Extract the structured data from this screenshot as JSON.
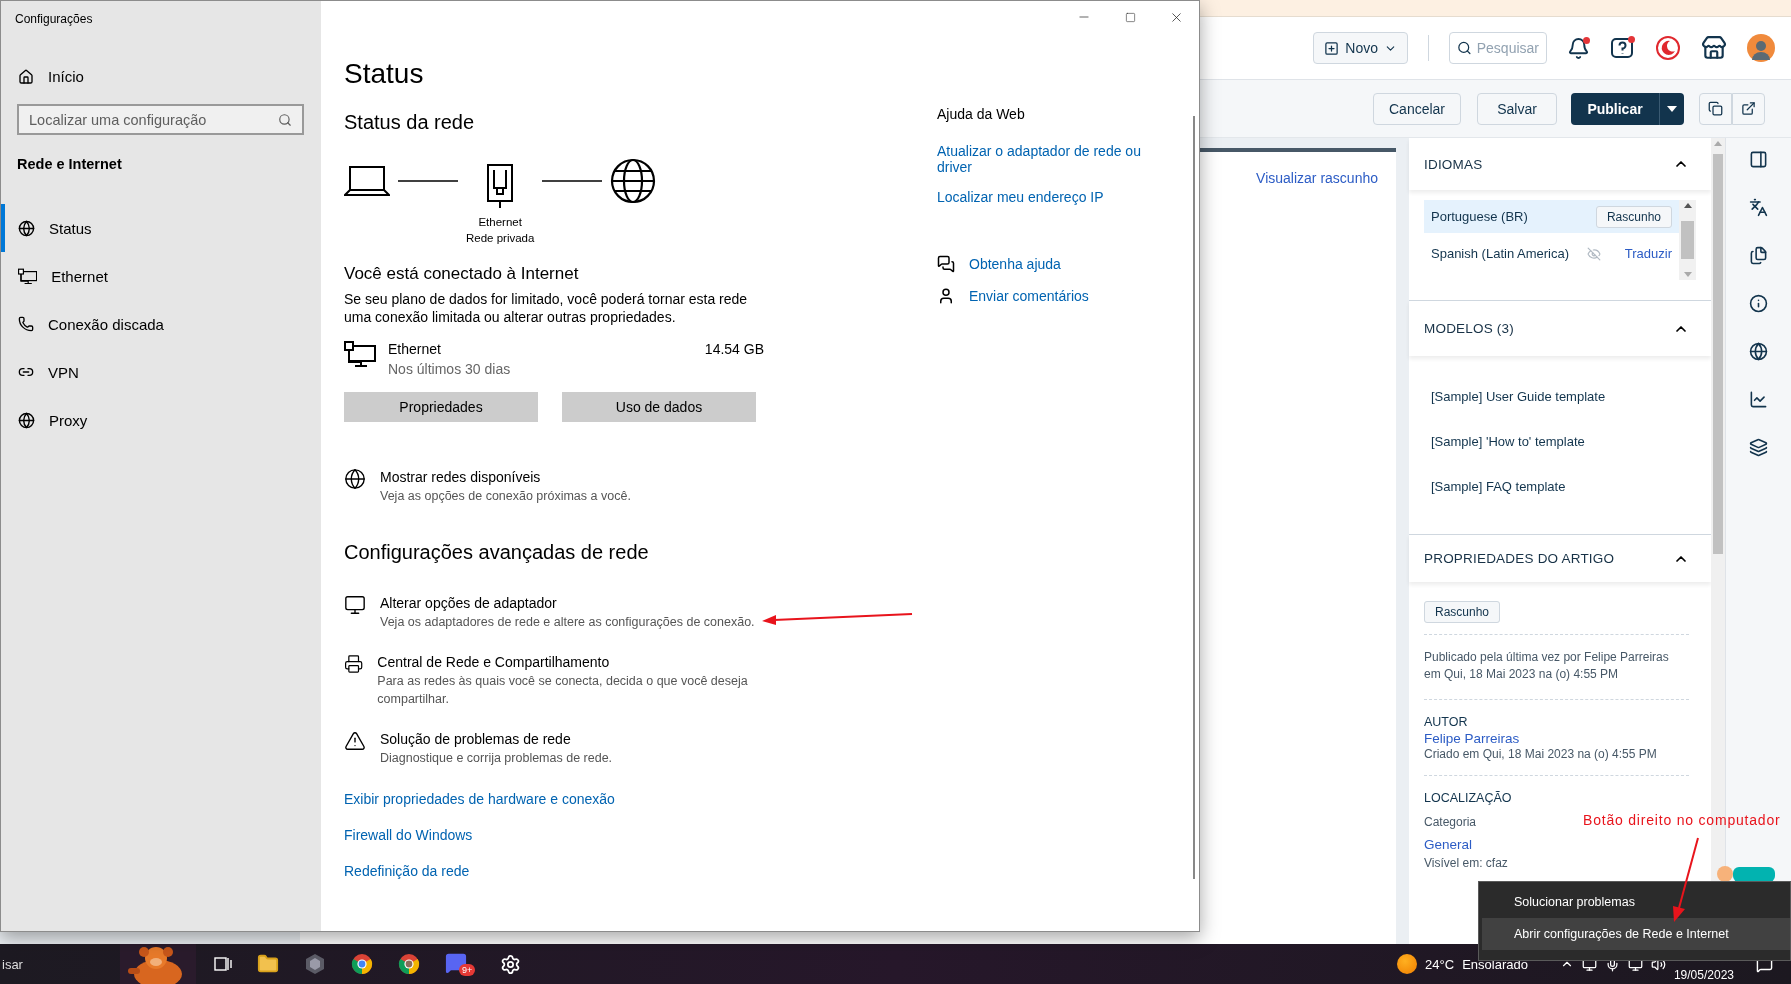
{
  "settings_window": {
    "title": "Configurações",
    "sidebar": {
      "home": "Início",
      "search_placeholder": "Localizar uma configuração",
      "section": "Rede e Internet",
      "items": [
        {
          "label": "Status",
          "selected": true
        },
        {
          "label": "Ethernet",
          "selected": false
        },
        {
          "label": "Conexão discada",
          "selected": false
        },
        {
          "label": "VPN",
          "selected": false
        },
        {
          "label": "Proxy",
          "selected": false
        }
      ]
    },
    "page": {
      "title": "Status",
      "network_heading": "Status da rede",
      "diagram": {
        "adapter": "Ethernet",
        "network": "Rede privada"
      },
      "connected": "Você está conectado à Internet",
      "description": "Se seu plano de dados for limitado, você poderá tornar esta rede uma conexão limitada ou alterar outras propriedades.",
      "usage": {
        "name": "Ethernet",
        "period": "Nos últimos 30 dias",
        "amount": "14.54 GB"
      },
      "buttons": [
        "Propriedades",
        "Uso de dados"
      ],
      "show_networks": {
        "title": "Mostrar redes disponíveis",
        "subtitle": "Veja as opções de conexão próximas a você."
      },
      "advanced_heading": "Configurações avançadas de rede",
      "advanced_items": [
        {
          "title": "Alterar opções de adaptador",
          "subtitle": "Veja os adaptadores de rede e altere as configurações de conexão."
        },
        {
          "title": "Central de Rede e Compartilhamento",
          "subtitle": "Para as redes às quais você se conecta, decida o que você deseja compartilhar."
        },
        {
          "title": "Solução de problemas de rede",
          "subtitle": "Diagnostique e corrija problemas de rede."
        }
      ],
      "links": [
        "Exibir propriedades de hardware e conexão",
        "Firewall do Windows",
        "Redefinição da rede"
      ],
      "help": {
        "title": "Ajuda da Web",
        "links": [
          "Atualizar o adaptador de rede ou driver",
          "Localizar meu endereço IP"
        ],
        "actions": [
          "Obtenha ajuda",
          "Enviar comentários"
        ]
      }
    }
  },
  "web_app": {
    "header": {
      "new_button": "Novo",
      "search_placeholder": "Pesquisar"
    },
    "toolbar": {
      "buttons": [
        "Cancelar",
        "Salvar"
      ],
      "publish": "Publicar"
    },
    "preview_link": "Visualizar rascunho",
    "languages": {
      "title": "IDIOMAS",
      "expanded": true,
      "items": [
        {
          "name": "Portuguese (BR)",
          "selected": true,
          "status": "Rascunho"
        },
        {
          "name": "Spanish (Latin America)",
          "selected": false,
          "action": "Traduzir"
        }
      ]
    },
    "templates": {
      "title": "MODELOS (3)",
      "expanded": true,
      "items": [
        "[Sample] User Guide template",
        "[Sample] 'How to' template",
        "[Sample] FAQ template"
      ]
    },
    "properties": {
      "title": "PROPRIEDADES DO ARTIGO",
      "expanded": true,
      "status": "Rascunho",
      "published": "Publicado pela última vez por Felipe Parreiras em Qui, 18 Mai 2023 na (o) 4:55 PM",
      "author_label": "AUTOR",
      "author": "Felipe Parreiras",
      "created": "Criado em Qui, 18 Mai 2023 na (o) 4:55 PM",
      "location_label": "LOCALIZAÇÃO",
      "category_label": "Categoria",
      "category": "General",
      "visible": "Visível em: cfaz"
    }
  },
  "context_menu": {
    "items": [
      {
        "label": "Solucionar problemas",
        "selected": false
      },
      {
        "label": "Abrir configurações de Rede e Internet",
        "selected": true
      }
    ]
  },
  "annotation": {
    "text": "Botão direito no computador"
  },
  "taskbar": {
    "search_text": "isar",
    "badge": "9+",
    "weather": {
      "temperature": "24°C",
      "condition": "Ensolarado"
    },
    "date": "19/05/2023"
  }
}
